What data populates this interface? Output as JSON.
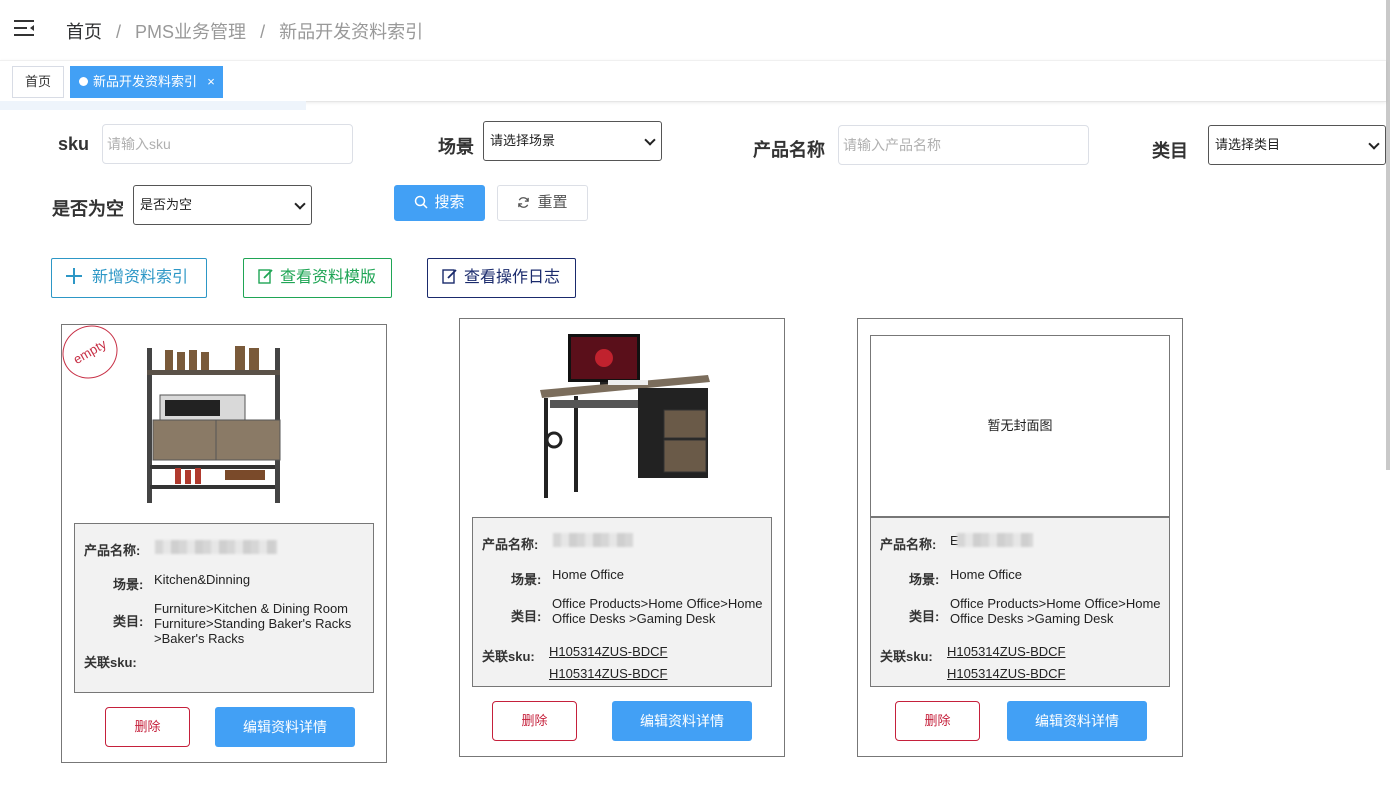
{
  "header": {
    "breadcrumb": [
      "首页",
      "PMS业务管理",
      "新品开发资料索引"
    ],
    "separator": "/"
  },
  "tabs": [
    {
      "label": "首页",
      "active": false
    },
    {
      "label": "新品开发资料索引",
      "active": true,
      "close": "×"
    }
  ],
  "filters": {
    "sku_label": "sku",
    "sku_placeholder": "请输入sku",
    "scene_label": "场景",
    "scene_value": "请选择场景",
    "name_label": "产品名称",
    "name_placeholder": "请输入产品名称",
    "category_label": "类目",
    "category_value": "请选择类目",
    "empty_label": "是否为空",
    "empty_value": "是否为空",
    "search_label": "搜索",
    "reset_label": "重置"
  },
  "actions": {
    "add": "新增资料索引",
    "template": "查看资料模版",
    "log": "查看操作日志"
  },
  "field_labels": {
    "name": "产品名称:",
    "scene": "场景:",
    "category": "类目:",
    "sku": "关联sku:"
  },
  "cards": [
    {
      "stamp": "empty",
      "scene": "Kitchen&Dinning",
      "category": "Furniture>Kitchen & Dining Room Furniture>Standing Baker's Racks >Baker's Racks",
      "skus": [],
      "delete": "删除",
      "edit": "编辑资料详情"
    },
    {
      "scene": "Home Office",
      "category": "Office Products>Home Office>Home Office Desks >Gaming Desk",
      "skus": [
        "H105314ZUS-BDCF",
        "H105314ZUS-BDCF"
      ],
      "delete": "删除",
      "edit": "编辑资料详情"
    },
    {
      "no_cover": "暂无封面图",
      "name_prefix": "E",
      "scene": "Home Office",
      "category": "Office Products>Home Office>Home Office Desks >Gaming Desk",
      "skus": [
        "H105314ZUS-BDCF",
        "H105314ZUS-BDCF"
      ],
      "delete": "删除",
      "edit": "编辑资料详情"
    }
  ],
  "colors": {
    "primary": "#42a0f5",
    "danger": "#c5203b",
    "success": "#1fa555",
    "info": "#2d97c6",
    "navy": "#1a2a6c"
  }
}
